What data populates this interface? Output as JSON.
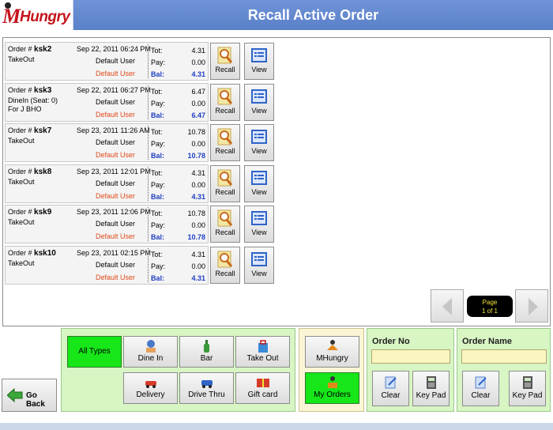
{
  "app": {
    "logo_text": "Hungry",
    "logo_letter": "M",
    "title": "Recall Active Order"
  },
  "orders": [
    {
      "prefix": "Order #",
      "number": "ksk2",
      "date": "Sep 22, 2011 06:24 PM",
      "type": "TakeOut",
      "type2": "",
      "user": "Default User",
      "user2": "Default User",
      "tot_label": "Tot:",
      "pay_label": "Pay:",
      "bal_label": "Bal:",
      "tot": "4.31",
      "pay": "0.00",
      "bal": "4.31"
    },
    {
      "prefix": "Order #",
      "number": "ksk3",
      "date": "Sep 22, 2011 06:27 PM",
      "type": "DineIn (Seat: 0)",
      "type2": "For J BHO",
      "user": "Default User",
      "user2": "Default User",
      "tot_label": "Tot:",
      "pay_label": "Pay:",
      "bal_label": "Bal:",
      "tot": "6.47",
      "pay": "0.00",
      "bal": "6.47"
    },
    {
      "prefix": "Order #",
      "number": "ksk7",
      "date": "Sep 23, 2011 11:26 AM",
      "type": "TakeOut",
      "type2": "",
      "user": "Default User",
      "user2": "Default User",
      "tot_label": "Tot:",
      "pay_label": "Pay:",
      "bal_label": "Bal:",
      "tot": "10.78",
      "pay": "0.00",
      "bal": "10.78"
    },
    {
      "prefix": "Order #",
      "number": "ksk8",
      "date": "Sep 23, 2011 12:01 PM",
      "type": "TakeOut",
      "type2": "",
      "user": "Default User",
      "user2": "Default User",
      "tot_label": "Tot:",
      "pay_label": "Pay:",
      "bal_label": "Bal:",
      "tot": "4.31",
      "pay": "0.00",
      "bal": "4.31"
    },
    {
      "prefix": "Order #",
      "number": "ksk9",
      "date": "Sep 23, 2011 12:06 PM",
      "type": "TakeOut",
      "type2": "",
      "user": "Default User",
      "user2": "Default User",
      "tot_label": "Tot:",
      "pay_label": "Pay:",
      "bal_label": "Bal:",
      "tot": "10.78",
      "pay": "0.00",
      "bal": "10.78"
    },
    {
      "prefix": "Order #",
      "number": "ksk10",
      "date": "Sep 23, 2011 02:15 PM",
      "type": "TakeOut",
      "type2": "",
      "user": "Default User",
      "user2": "Default User",
      "tot_label": "Tot:",
      "pay_label": "Pay:",
      "bal_label": "Bal:",
      "tot": "4.31",
      "pay": "0.00",
      "bal": "4.31"
    }
  ],
  "row_actions": {
    "recall": "Recall",
    "view": "View"
  },
  "pager": {
    "line1": "Page",
    "line2": "1 of 1"
  },
  "nav": {
    "go_back": "Go Back"
  },
  "types": {
    "all": "All Types",
    "dine_in": "Dine In",
    "bar": "Bar",
    "take_out": "Take Out",
    "delivery": "Delivery",
    "drive_thru": "Drive Thru",
    "gift_card": "Gift card"
  },
  "modes": {
    "mhungry": "MHungry",
    "my_orders": "My Orders"
  },
  "order_no": {
    "title": "Order No",
    "value": "",
    "clear": "Clear",
    "keypad": "Key Pad"
  },
  "order_name": {
    "title": "Order Name",
    "value": "",
    "clear": "Clear",
    "keypad": "Key Pad"
  },
  "colors": {
    "title_bar": "#6f93d8",
    "active_green": "#17e619",
    "panel_green": "#d8f5c4",
    "balance_blue": "#1f3fc4",
    "user_orange": "#e0491c"
  }
}
